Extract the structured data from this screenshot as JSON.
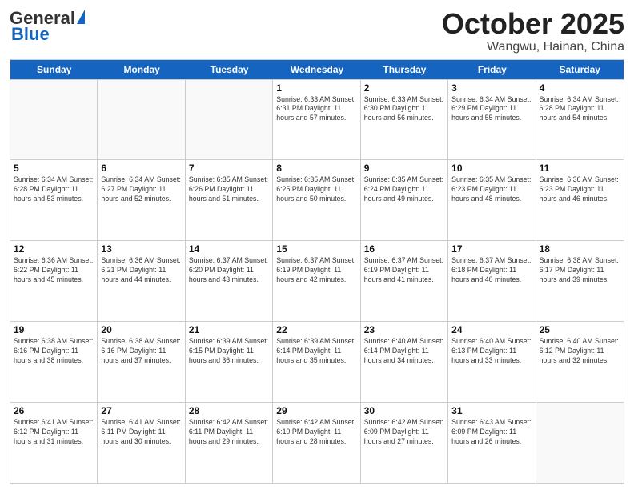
{
  "logo": {
    "general": "General",
    "blue": "Blue",
    "subtitle": ""
  },
  "header": {
    "month": "October 2025",
    "location": "Wangwu, Hainan, China"
  },
  "weekdays": [
    "Sunday",
    "Monday",
    "Tuesday",
    "Wednesday",
    "Thursday",
    "Friday",
    "Saturday"
  ],
  "rows": [
    [
      {
        "day": "",
        "info": ""
      },
      {
        "day": "",
        "info": ""
      },
      {
        "day": "",
        "info": ""
      },
      {
        "day": "1",
        "info": "Sunrise: 6:33 AM\nSunset: 6:31 PM\nDaylight: 11 hours and 57 minutes."
      },
      {
        "day": "2",
        "info": "Sunrise: 6:33 AM\nSunset: 6:30 PM\nDaylight: 11 hours and 56 minutes."
      },
      {
        "day": "3",
        "info": "Sunrise: 6:34 AM\nSunset: 6:29 PM\nDaylight: 11 hours and 55 minutes."
      },
      {
        "day": "4",
        "info": "Sunrise: 6:34 AM\nSunset: 6:28 PM\nDaylight: 11 hours and 54 minutes."
      }
    ],
    [
      {
        "day": "5",
        "info": "Sunrise: 6:34 AM\nSunset: 6:28 PM\nDaylight: 11 hours and 53 minutes."
      },
      {
        "day": "6",
        "info": "Sunrise: 6:34 AM\nSunset: 6:27 PM\nDaylight: 11 hours and 52 minutes."
      },
      {
        "day": "7",
        "info": "Sunrise: 6:35 AM\nSunset: 6:26 PM\nDaylight: 11 hours and 51 minutes."
      },
      {
        "day": "8",
        "info": "Sunrise: 6:35 AM\nSunset: 6:25 PM\nDaylight: 11 hours and 50 minutes."
      },
      {
        "day": "9",
        "info": "Sunrise: 6:35 AM\nSunset: 6:24 PM\nDaylight: 11 hours and 49 minutes."
      },
      {
        "day": "10",
        "info": "Sunrise: 6:35 AM\nSunset: 6:23 PM\nDaylight: 11 hours and 48 minutes."
      },
      {
        "day": "11",
        "info": "Sunrise: 6:36 AM\nSunset: 6:23 PM\nDaylight: 11 hours and 46 minutes."
      }
    ],
    [
      {
        "day": "12",
        "info": "Sunrise: 6:36 AM\nSunset: 6:22 PM\nDaylight: 11 hours and 45 minutes."
      },
      {
        "day": "13",
        "info": "Sunrise: 6:36 AM\nSunset: 6:21 PM\nDaylight: 11 hours and 44 minutes."
      },
      {
        "day": "14",
        "info": "Sunrise: 6:37 AM\nSunset: 6:20 PM\nDaylight: 11 hours and 43 minutes."
      },
      {
        "day": "15",
        "info": "Sunrise: 6:37 AM\nSunset: 6:19 PM\nDaylight: 11 hours and 42 minutes."
      },
      {
        "day": "16",
        "info": "Sunrise: 6:37 AM\nSunset: 6:19 PM\nDaylight: 11 hours and 41 minutes."
      },
      {
        "day": "17",
        "info": "Sunrise: 6:37 AM\nSunset: 6:18 PM\nDaylight: 11 hours and 40 minutes."
      },
      {
        "day": "18",
        "info": "Sunrise: 6:38 AM\nSunset: 6:17 PM\nDaylight: 11 hours and 39 minutes."
      }
    ],
    [
      {
        "day": "19",
        "info": "Sunrise: 6:38 AM\nSunset: 6:16 PM\nDaylight: 11 hours and 38 minutes."
      },
      {
        "day": "20",
        "info": "Sunrise: 6:38 AM\nSunset: 6:16 PM\nDaylight: 11 hours and 37 minutes."
      },
      {
        "day": "21",
        "info": "Sunrise: 6:39 AM\nSunset: 6:15 PM\nDaylight: 11 hours and 36 minutes."
      },
      {
        "day": "22",
        "info": "Sunrise: 6:39 AM\nSunset: 6:14 PM\nDaylight: 11 hours and 35 minutes."
      },
      {
        "day": "23",
        "info": "Sunrise: 6:40 AM\nSunset: 6:14 PM\nDaylight: 11 hours and 34 minutes."
      },
      {
        "day": "24",
        "info": "Sunrise: 6:40 AM\nSunset: 6:13 PM\nDaylight: 11 hours and 33 minutes."
      },
      {
        "day": "25",
        "info": "Sunrise: 6:40 AM\nSunset: 6:12 PM\nDaylight: 11 hours and 32 minutes."
      }
    ],
    [
      {
        "day": "26",
        "info": "Sunrise: 6:41 AM\nSunset: 6:12 PM\nDaylight: 11 hours and 31 minutes."
      },
      {
        "day": "27",
        "info": "Sunrise: 6:41 AM\nSunset: 6:11 PM\nDaylight: 11 hours and 30 minutes."
      },
      {
        "day": "28",
        "info": "Sunrise: 6:42 AM\nSunset: 6:11 PM\nDaylight: 11 hours and 29 minutes."
      },
      {
        "day": "29",
        "info": "Sunrise: 6:42 AM\nSunset: 6:10 PM\nDaylight: 11 hours and 28 minutes."
      },
      {
        "day": "30",
        "info": "Sunrise: 6:42 AM\nSunset: 6:09 PM\nDaylight: 11 hours and 27 minutes."
      },
      {
        "day": "31",
        "info": "Sunrise: 6:43 AM\nSunset: 6:09 PM\nDaylight: 11 hours and 26 minutes."
      },
      {
        "day": "",
        "info": ""
      }
    ]
  ]
}
